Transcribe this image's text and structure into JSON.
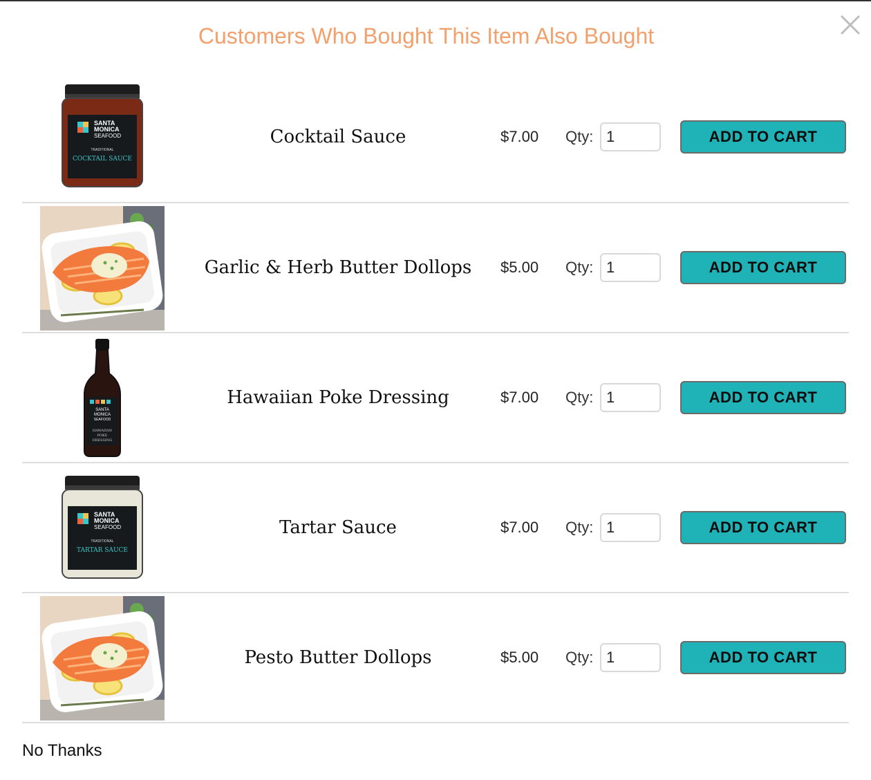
{
  "dialog": {
    "title": "Customers Who Bought This Item Also Bought",
    "close_icon": "close-icon",
    "no_thanks_label": "No Thanks"
  },
  "qty_label": "Qty:",
  "add_to_cart_label": "ADD TO CART",
  "products": [
    {
      "name": "Cocktail Sauce",
      "price": "$7.00",
      "qty": "1",
      "image": "jar",
      "jar_fill": "#7a2a15",
      "label_lines": [
        "SANTA",
        "MONICA",
        "SEAFOOD"
      ],
      "label_tag": "TRADITIONAL",
      "label_product": "COCKTAIL SAUCE"
    },
    {
      "name": "Garlic & Herb Butter Dollops",
      "price": "$5.00",
      "qty": "1",
      "image": "salmon"
    },
    {
      "name": "Hawaiian Poke Dressing",
      "price": "$7.00",
      "qty": "1",
      "image": "bottle",
      "label_lines": [
        "SANTA",
        "MONICA",
        "SEAFOOD"
      ],
      "label_product": "HAWAIIAN POKE DRESSING"
    },
    {
      "name": "Tartar Sauce",
      "price": "$7.00",
      "qty": "1",
      "image": "jar",
      "jar_fill": "#e8e6d8",
      "label_lines": [
        "SANTA",
        "MONICA",
        "SEAFOOD"
      ],
      "label_tag": "TRADITIONAL",
      "label_product": "TARTAR SAUCE"
    },
    {
      "name": "Pesto Butter Dollops",
      "price": "$5.00",
      "qty": "1",
      "image": "salmon"
    }
  ],
  "colors": {
    "title": "#f2a06c",
    "button": "#1fb3b8",
    "divider": "#dddddd"
  }
}
